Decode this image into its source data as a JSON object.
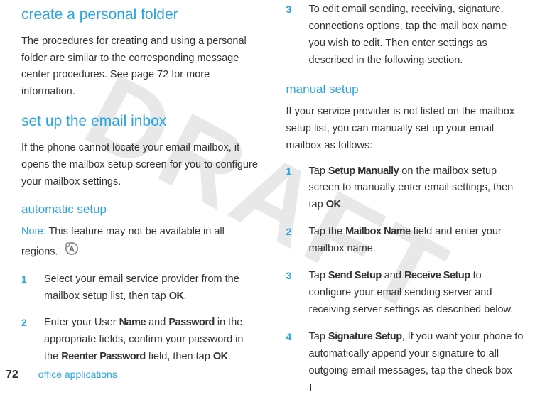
{
  "watermark": "DRAFT",
  "left": {
    "h1_a": "create a personal folder",
    "p1": "The procedures for creating and using a personal folder are similar to the corresponding message center procedures. See page 72 for more information.",
    "h1_b": "set up the email inbox",
    "p2": "If the phone cannot locate your email mailbox, it opens the mailbox setup screen for you to configure your mailbox settings.",
    "h2_a": "automatic setup",
    "note_label": "Note:",
    "note_text": " This feature may not be available in all regions.",
    "step1_num": "1",
    "step1_a": "Select your email service provider from the mailbox setup list, then tap ",
    "step1_ok": "OK",
    "step1_b": ".",
    "step2_num": "2",
    "step2_a": "Enter your User ",
    "step2_name": "Name",
    "step2_b": " and ",
    "step2_pw": "Password",
    "step2_c": " in the appropriate fields, confirm your password in the ",
    "step2_re": "Reenter Password",
    "step2_d": " field, then tap ",
    "step2_ok": "OK",
    "step2_e": "."
  },
  "right": {
    "step3_num": "3",
    "step3": "To edit email sending, receiving, signature, connections options, tap the mail box name you wish to edit. Then enter settings as described in the following section.",
    "h2_a": "manual setup",
    "p1": "If your service provider is not listed on the mailbox setup list, you can manually set up your email mailbox as follows:",
    "m1_num": "1",
    "m1_a": "Tap ",
    "m1_sm": "Setup Manually",
    "m1_b": " on the mailbox setup screen to manually enter email settings, then tap ",
    "m1_ok": "OK",
    "m1_c": ".",
    "m2_num": "2",
    "m2_a": "Tap the ",
    "m2_mn": "Mailbox Name",
    "m2_b": " field and enter your mailbox name.",
    "m3_num": "3",
    "m3_a": "Tap ",
    "m3_ss": "Send Setup",
    "m3_b": " and ",
    "m3_rs": "Receive Setup",
    "m3_c": " to configure your email sending server and receiving server settings as described below.",
    "m4_num": "4",
    "m4_a": "Tap ",
    "m4_sig": "Signature Setup",
    "m4_b": ", If you want your phone to automatically append your signature to all outgoing email messages, tap the check box "
  },
  "footer": {
    "page": "72",
    "title": "office applications"
  }
}
